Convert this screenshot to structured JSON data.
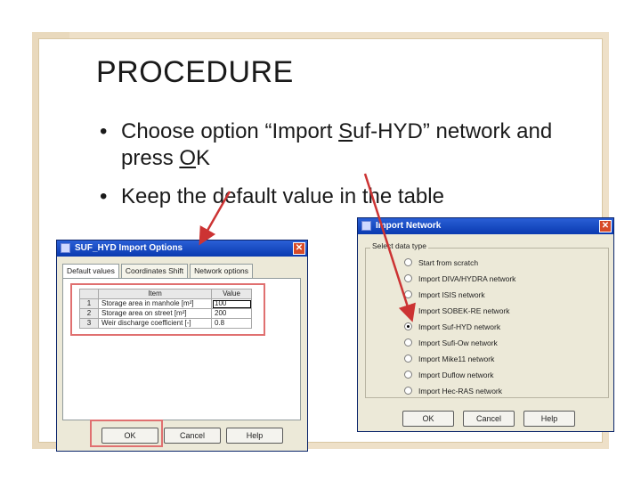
{
  "slide": {
    "title": "PROCEDURE",
    "bullets": [
      {
        "pre": "Choose option “Import ",
        "u1": "S",
        "mid": "uf-HYD” network and press ",
        "u2": "O",
        "post": "K"
      },
      {
        "text": "Keep the default value in the table"
      }
    ]
  },
  "dialog1": {
    "title": "SUF_HYD Import Options",
    "tabs": [
      "Default values",
      "Coordinates Shift",
      "Network options"
    ],
    "table": {
      "headers": [
        "",
        "Item",
        "Value"
      ],
      "rows": [
        {
          "n": "1",
          "item": "Storage area in manhole [m²]",
          "value": "100"
        },
        {
          "n": "2",
          "item": "Storage area on street [m²]",
          "value": "200"
        },
        {
          "n": "3",
          "item": "Weir discharge coefficient [-]",
          "value": "0.8"
        }
      ]
    },
    "buttons": {
      "ok": "OK",
      "cancel": "Cancel",
      "help": "Help"
    }
  },
  "dialog2": {
    "title": "Import Network",
    "group_label": "Select data type",
    "options": [
      "Start from scratch",
      "Import DIVA/HYDRA network",
      "Import ISIS network",
      "Import SOBEK-RE network",
      "Import Suf-HYD network",
      "Import Sufi-Ow network",
      "Import Mike11 network",
      "Import Duflow network",
      "Import Hec-RAS network"
    ],
    "selected_index": 4,
    "buttons": {
      "ok": "OK",
      "cancel": "Cancel",
      "help": "Help"
    }
  },
  "colors": {
    "frame": "#eee0c8",
    "titlebar": "#0a3ab0",
    "highlight": "#e07070",
    "arrow": "#cc3333"
  }
}
